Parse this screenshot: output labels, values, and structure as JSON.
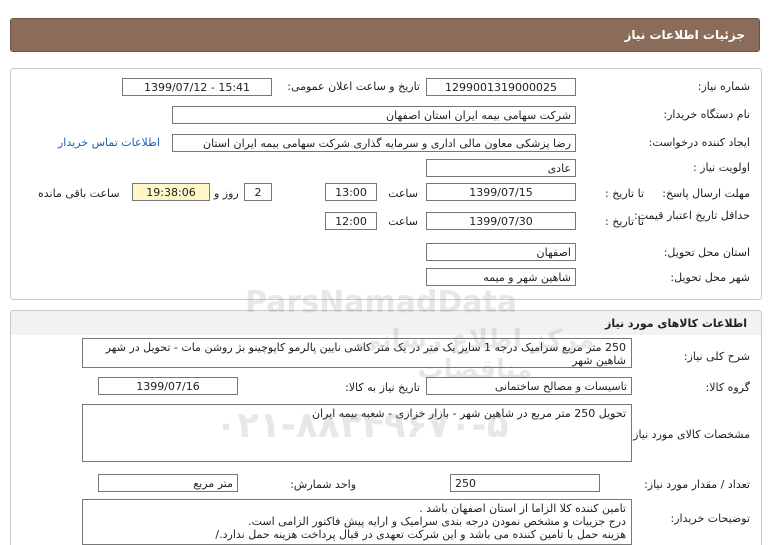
{
  "header": {
    "title": "جزئیات اطلاعات نیاز"
  },
  "info": {
    "need_number_label": "شماره نیاز:",
    "need_number": "1299001319000025",
    "announce_label": "تاریخ و ساعت اعلان عمومی:",
    "announce_value": "1399/07/12 - 15:41",
    "buyer_org_label": "نام دستگاه خریدار:",
    "buyer_org": "شرکت سهامی بیمه ایران استان اصفهان",
    "requester_label": "ایجاد کننده درخواست:",
    "requester": "رضا پزشکی معاون مالی اداری و سرمایه گذاری شرکت سهامی بیمه ایران استان",
    "contact_link": "اطلاعات تماس خریدار",
    "priority_label": "اولویت نیاز :",
    "priority": "عادی",
    "reply_deadline_label": "مهلت ارسال پاسخ:",
    "to_date_label": "تا تاریخ :",
    "reply_date": "1399/07/15",
    "time_label": "ساعت",
    "reply_time": "13:00",
    "days_value": "2",
    "days_label": "روز و",
    "remaining_time": "19:38:06",
    "remaining_label": "ساعت باقی مانده",
    "validity_label": "حداقل تاریخ اعتبار قیمت:",
    "validity_date": "1399/07/30",
    "validity_time": "12:00",
    "province_label": "استان محل تحویل:",
    "province": "اصفهان",
    "city_label": "شهر محل تحویل:",
    "city": "شاهین شهر و میمه"
  },
  "goods": {
    "section_title": "اطلاعات کالاهای مورد نیاز",
    "summary_label": "شرح کلی نیاز:",
    "summary": "250 متر مربع سرامیک درجه 1 سایز یک متر در یک متر کاشی نایین پالرمو کاپوچینو بژ روشن مات - تحویل در شهر شاهین شهر",
    "group_label": "گروه کالا:",
    "group": "تاسیسات و مصالح ساختمانی",
    "need_date_label": "تاریخ نیاز به کالا:",
    "need_date": "1399/07/16",
    "specs_label": "مشخصات کالای مورد نیاز:",
    "specs": "تحویل 250 متر مربع در شاهین شهر - بازار خزازی - شعبه بیمه ایران",
    "quantity_label": "تعداد / مقدار مورد نیاز:",
    "quantity": "250",
    "unit_label": "واحد شمارش:",
    "unit": "متر مربع",
    "buyer_notes_label": "توضیحات خریدار:",
    "buyer_notes": [
      "تامین کننده کلا الزاما از استان اصفهان باشد .",
      "درج جزییات و مشخص نمودن درجه بندی سرامیک و ارایه پیش فاکتور الزامی است.",
      "هزینه حمل با تامین کننده می باشد و این شرکت تعهدی در قبال پرداخت هزینه حمل ندارد./"
    ]
  },
  "watermark": {
    "line1": "ParsNamadData",
    "line2": "مرکز اطلاع رسانی مناقصات",
    "line3": "۰۲۱-۸۸۳۴۹۶۷۰-۵"
  }
}
